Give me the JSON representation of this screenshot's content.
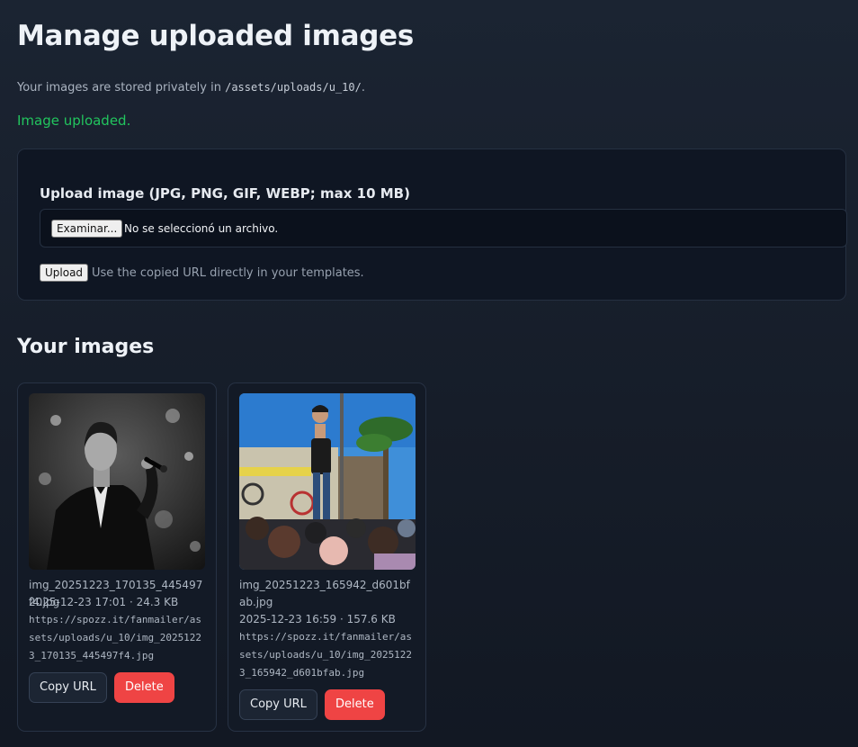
{
  "page": {
    "title": "Manage uploaded images",
    "storage_prefix": "Your images are stored privately in ",
    "storage_path": "/assets/uploads/u_10/",
    "storage_suffix": ".",
    "flash": "Image uploaded."
  },
  "upload": {
    "label": "Upload image (JPG, PNG, GIF, WEBP; max 10 MB)",
    "browse_label": "Examinar...",
    "no_file_text": "No se seleccionó un archivo.",
    "submit_label": "Upload",
    "hint": "Use the copied URL directly in your templates."
  },
  "gallery": {
    "heading": "Your images",
    "images": [
      {
        "filename": "img_20251223_170135_445497f4.jpg",
        "meta": "2025-12-23 17:01 · 24.3 KB",
        "url": "https://spozz.it/fanmailer/assets/uploads/u_10/img_20251223_170135_445497f4.jpg",
        "thumb_icon": "singer-bw-photo",
        "copy_label": "Copy URL",
        "delete_label": "Delete"
      },
      {
        "filename": "img_20251223_165942_d601bfab.jpg",
        "meta": "2025-12-23 16:59 · 157.6 KB",
        "url": "https://spozz.it/fanmailer/assets/uploads/u_10/img_20251223_165942_d601bfab.jpg",
        "thumb_icon": "stage-crowd-photo",
        "copy_label": "Copy URL",
        "delete_label": "Delete"
      }
    ]
  },
  "colors": {
    "success": "#22c55e",
    "danger": "#ef4444",
    "background": "#1b2432"
  }
}
